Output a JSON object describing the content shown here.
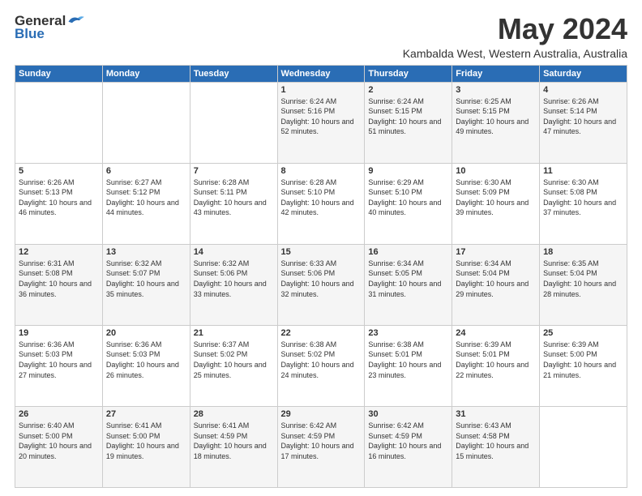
{
  "logo": {
    "general": "General",
    "blue": "Blue"
  },
  "title": "May 2024",
  "subtitle": "Kambalda West, Western Australia, Australia",
  "days_of_week": [
    "Sunday",
    "Monday",
    "Tuesday",
    "Wednesday",
    "Thursday",
    "Friday",
    "Saturday"
  ],
  "weeks": [
    [
      {
        "day": "",
        "info": ""
      },
      {
        "day": "",
        "info": ""
      },
      {
        "day": "",
        "info": ""
      },
      {
        "day": "1",
        "info": "Sunrise: 6:24 AM\nSunset: 5:16 PM\nDaylight: 10 hours and 52 minutes."
      },
      {
        "day": "2",
        "info": "Sunrise: 6:24 AM\nSunset: 5:15 PM\nDaylight: 10 hours and 51 minutes."
      },
      {
        "day": "3",
        "info": "Sunrise: 6:25 AM\nSunset: 5:15 PM\nDaylight: 10 hours and 49 minutes."
      },
      {
        "day": "4",
        "info": "Sunrise: 6:26 AM\nSunset: 5:14 PM\nDaylight: 10 hours and 47 minutes."
      }
    ],
    [
      {
        "day": "5",
        "info": "Sunrise: 6:26 AM\nSunset: 5:13 PM\nDaylight: 10 hours and 46 minutes."
      },
      {
        "day": "6",
        "info": "Sunrise: 6:27 AM\nSunset: 5:12 PM\nDaylight: 10 hours and 44 minutes."
      },
      {
        "day": "7",
        "info": "Sunrise: 6:28 AM\nSunset: 5:11 PM\nDaylight: 10 hours and 43 minutes."
      },
      {
        "day": "8",
        "info": "Sunrise: 6:28 AM\nSunset: 5:10 PM\nDaylight: 10 hours and 42 minutes."
      },
      {
        "day": "9",
        "info": "Sunrise: 6:29 AM\nSunset: 5:10 PM\nDaylight: 10 hours and 40 minutes."
      },
      {
        "day": "10",
        "info": "Sunrise: 6:30 AM\nSunset: 5:09 PM\nDaylight: 10 hours and 39 minutes."
      },
      {
        "day": "11",
        "info": "Sunrise: 6:30 AM\nSunset: 5:08 PM\nDaylight: 10 hours and 37 minutes."
      }
    ],
    [
      {
        "day": "12",
        "info": "Sunrise: 6:31 AM\nSunset: 5:08 PM\nDaylight: 10 hours and 36 minutes."
      },
      {
        "day": "13",
        "info": "Sunrise: 6:32 AM\nSunset: 5:07 PM\nDaylight: 10 hours and 35 minutes."
      },
      {
        "day": "14",
        "info": "Sunrise: 6:32 AM\nSunset: 5:06 PM\nDaylight: 10 hours and 33 minutes."
      },
      {
        "day": "15",
        "info": "Sunrise: 6:33 AM\nSunset: 5:06 PM\nDaylight: 10 hours and 32 minutes."
      },
      {
        "day": "16",
        "info": "Sunrise: 6:34 AM\nSunset: 5:05 PM\nDaylight: 10 hours and 31 minutes."
      },
      {
        "day": "17",
        "info": "Sunrise: 6:34 AM\nSunset: 5:04 PM\nDaylight: 10 hours and 29 minutes."
      },
      {
        "day": "18",
        "info": "Sunrise: 6:35 AM\nSunset: 5:04 PM\nDaylight: 10 hours and 28 minutes."
      }
    ],
    [
      {
        "day": "19",
        "info": "Sunrise: 6:36 AM\nSunset: 5:03 PM\nDaylight: 10 hours and 27 minutes."
      },
      {
        "day": "20",
        "info": "Sunrise: 6:36 AM\nSunset: 5:03 PM\nDaylight: 10 hours and 26 minutes."
      },
      {
        "day": "21",
        "info": "Sunrise: 6:37 AM\nSunset: 5:02 PM\nDaylight: 10 hours and 25 minutes."
      },
      {
        "day": "22",
        "info": "Sunrise: 6:38 AM\nSunset: 5:02 PM\nDaylight: 10 hours and 24 minutes."
      },
      {
        "day": "23",
        "info": "Sunrise: 6:38 AM\nSunset: 5:01 PM\nDaylight: 10 hours and 23 minutes."
      },
      {
        "day": "24",
        "info": "Sunrise: 6:39 AM\nSunset: 5:01 PM\nDaylight: 10 hours and 22 minutes."
      },
      {
        "day": "25",
        "info": "Sunrise: 6:39 AM\nSunset: 5:00 PM\nDaylight: 10 hours and 21 minutes."
      }
    ],
    [
      {
        "day": "26",
        "info": "Sunrise: 6:40 AM\nSunset: 5:00 PM\nDaylight: 10 hours and 20 minutes."
      },
      {
        "day": "27",
        "info": "Sunrise: 6:41 AM\nSunset: 5:00 PM\nDaylight: 10 hours and 19 minutes."
      },
      {
        "day": "28",
        "info": "Sunrise: 6:41 AM\nSunset: 4:59 PM\nDaylight: 10 hours and 18 minutes."
      },
      {
        "day": "29",
        "info": "Sunrise: 6:42 AM\nSunset: 4:59 PM\nDaylight: 10 hours and 17 minutes."
      },
      {
        "day": "30",
        "info": "Sunrise: 6:42 AM\nSunset: 4:59 PM\nDaylight: 10 hours and 16 minutes."
      },
      {
        "day": "31",
        "info": "Sunrise: 6:43 AM\nSunset: 4:58 PM\nDaylight: 10 hours and 15 minutes."
      },
      {
        "day": "",
        "info": ""
      }
    ]
  ]
}
